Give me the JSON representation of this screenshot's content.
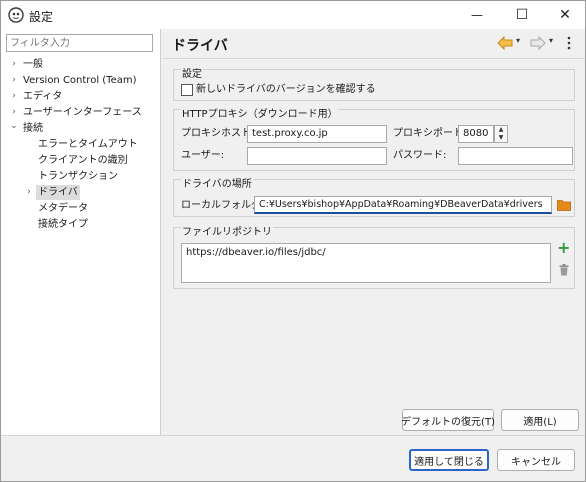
{
  "window": {
    "title": "設定",
    "minimize_glyph": "—",
    "maximize_glyph": "☐",
    "close_glyph": "✕"
  },
  "sidebar": {
    "filter_placeholder": "フィルタ入力",
    "items": [
      {
        "label": "一般",
        "arrow": "›"
      },
      {
        "label": "Version Control (Team)",
        "arrow": "›"
      },
      {
        "label": "エディタ",
        "arrow": "›"
      },
      {
        "label": "ユーザーインターフェース",
        "arrow": "›"
      },
      {
        "label": "接続",
        "arrow": "⌄"
      },
      {
        "label": "エラーとタイムアウト"
      },
      {
        "label": "クライアントの識別"
      },
      {
        "label": "トランザクション"
      },
      {
        "label": "ドライバ",
        "arrow": "›",
        "selected": true
      },
      {
        "label": "メタデータ"
      },
      {
        "label": "接続タイプ"
      }
    ]
  },
  "page": {
    "title": "ドライバ",
    "nav_dropdown_glyph": "▾",
    "settings_group": {
      "title": "設定",
      "check_updates_label": "新しいドライバのバージョンを確認する",
      "check_updates_checked": false
    },
    "http_proxy_group": {
      "title": "HTTPプロキシ（ダウンロード用）",
      "host_label": "プロキシホスト:",
      "host_value": "test.proxy.co.jp",
      "port_label": "プロキシポート:",
      "port_value": "8080",
      "user_label": "ユーザー:",
      "user_value": "",
      "password_label": "パスワード:",
      "password_value": "",
      "spinner_up": "▲",
      "spinner_down": "▼"
    },
    "driver_location_group": {
      "title": "ドライバの場所",
      "local_folder_label": "ローカルフォルダ:",
      "local_folder_value": "C:¥Users¥bishop¥AppData¥Roaming¥DBeaverData¥drivers"
    },
    "file_repository_group": {
      "title": "ファイルリポジトリ",
      "repositories": [
        "https://dbeaver.io/files/jdbc/"
      ],
      "add_glyph": "+"
    },
    "restore_defaults_button": "デフォルトの復元(T)",
    "apply_button": "適用(L)"
  },
  "footer": {
    "apply_and_close_button": "適用して閉じる",
    "cancel_button": "キャンセル"
  },
  "colors": {
    "accent": "#2b65c7",
    "add_icon": "#2e9e3a",
    "folder_icon": "#e07b10",
    "nav_back_icon": "#e8a020"
  }
}
